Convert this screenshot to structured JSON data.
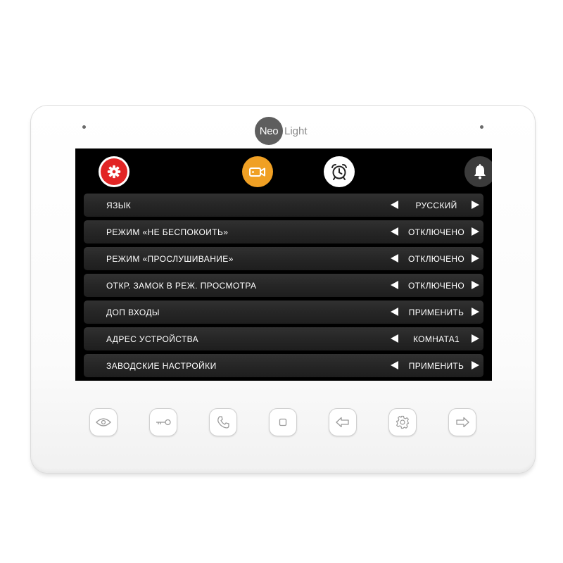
{
  "brand": {
    "logo_mark": "Neo",
    "logo_text": "Light"
  },
  "tabs": [
    {
      "icon": "gear-icon",
      "color": "#e22525",
      "selected": true
    },
    {
      "icon": "video-camera-icon",
      "color": "#f0a024"
    },
    {
      "icon": "alarm-clock-icon",
      "color": "#ffffff"
    },
    {
      "icon": "bell-icon",
      "color": "#3b3b3b"
    }
  ],
  "menu": {
    "items": [
      {
        "label": "ЯЗЫК",
        "value": "РУССКИЙ"
      },
      {
        "label": "РЕЖИМ «НЕ БЕСПОКОИТЬ»",
        "value": "ОТКЛЮЧЕНО"
      },
      {
        "label": "РЕЖИМ «ПРОСЛУШИВАНИЕ»",
        "value": "ОТКЛЮЧЕНО"
      },
      {
        "label": "ОТКР. ЗАМОК В РЕЖ. ПРОСМОТРА",
        "value": "ОТКЛЮЧЕНО"
      },
      {
        "label": "ДОП ВХОДЫ",
        "value": "ПРИМЕНИТЬ"
      },
      {
        "label": "АДРЕС УСТРОЙСТВА",
        "value": "КОМНАТА1"
      },
      {
        "label": "ЗАВОДСКИЕ НАСТРОЙКИ",
        "value": "ПРИМЕНИТЬ"
      }
    ]
  },
  "hardware_buttons": [
    "eye-icon",
    "key-icon",
    "phone-icon",
    "square-icon",
    "arrow-left-icon",
    "gear-icon",
    "arrow-right-icon"
  ]
}
